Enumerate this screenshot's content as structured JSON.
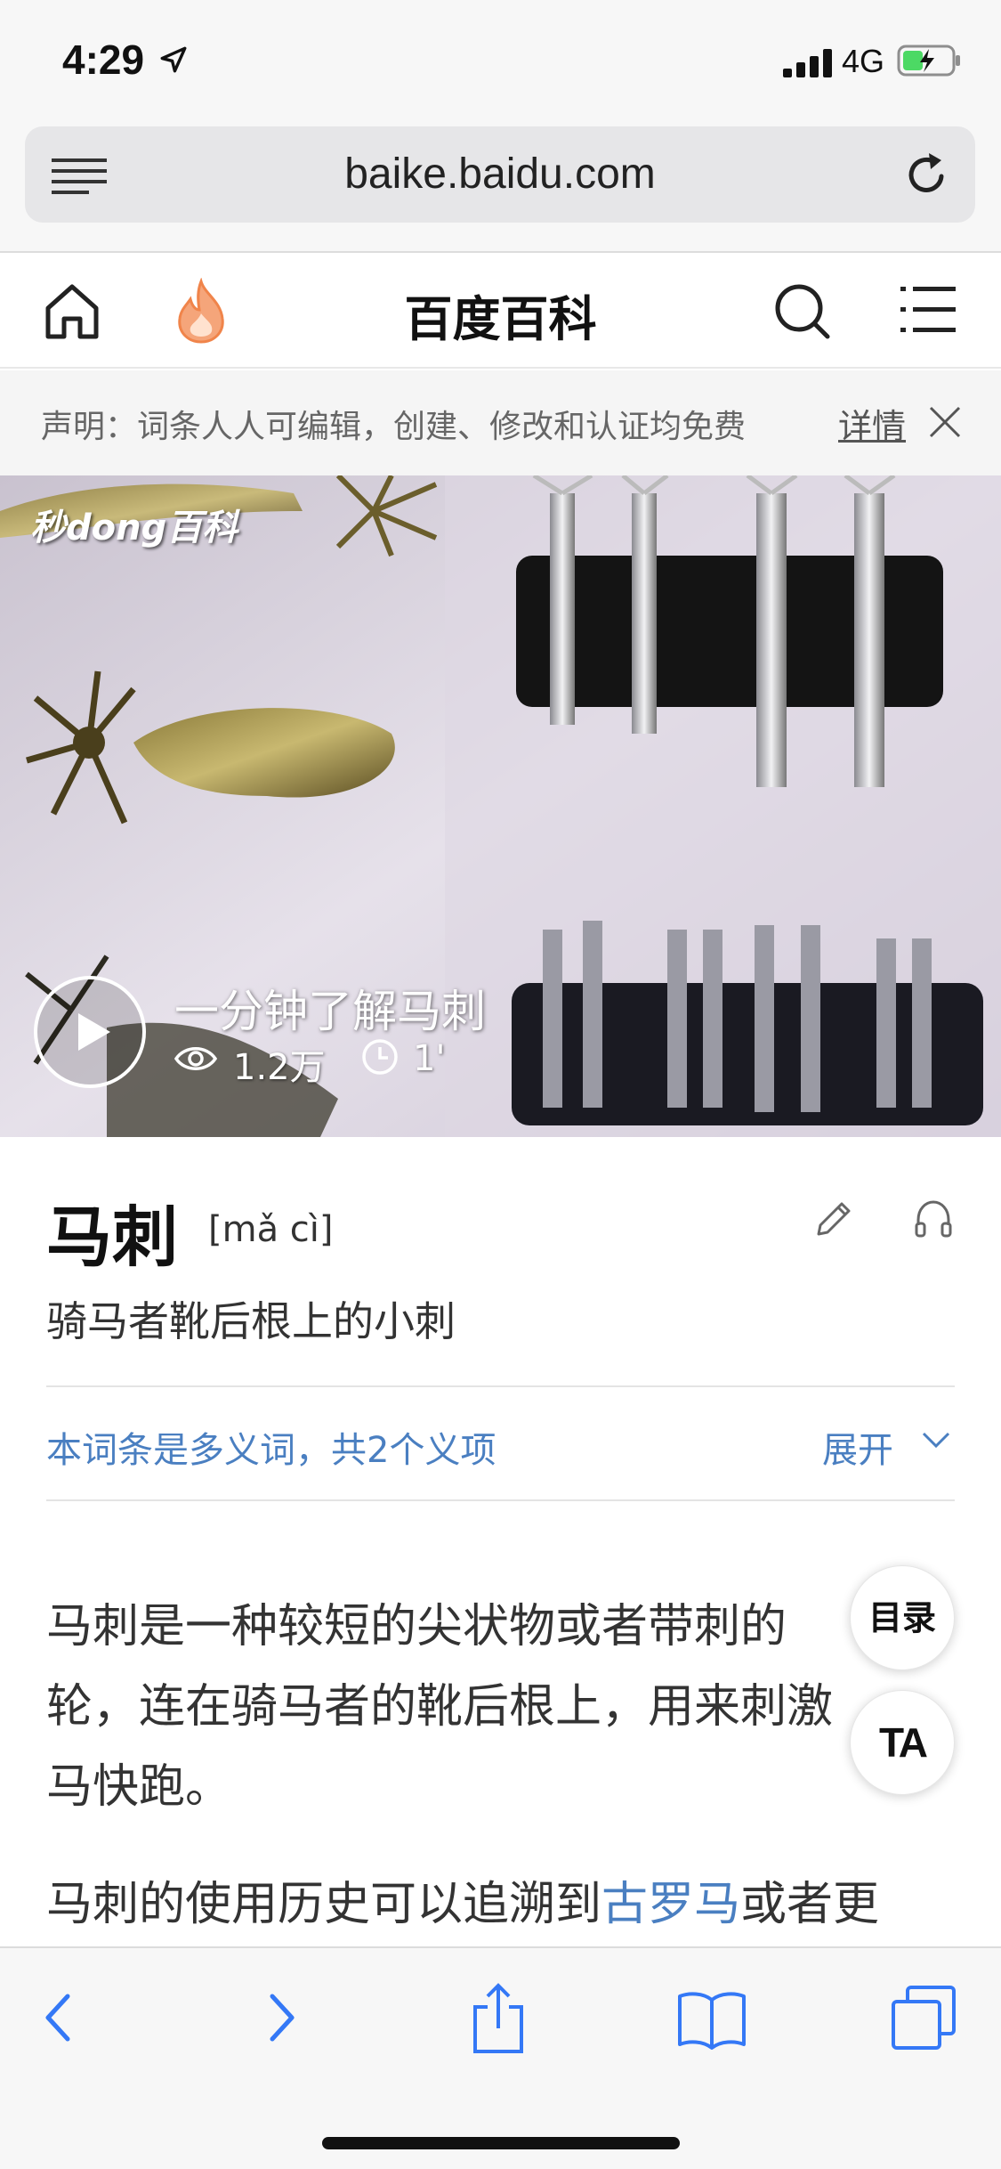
{
  "status": {
    "time": "4:29",
    "network": "4G"
  },
  "url_bar": {
    "url": "baike.baidu.com"
  },
  "header": {
    "title": "百度百科"
  },
  "notice": {
    "text": "声明：词条人人可编辑，创建、修改和认证均免费",
    "detail_label": "详情"
  },
  "video": {
    "watermark": "秒dong百科",
    "title": "一分钟了解马刺",
    "views": "1.2万",
    "duration": "1'"
  },
  "entry": {
    "title": "马刺",
    "pinyin": "[mǎ cì]",
    "summary": "骑马者靴后根上的小刺",
    "polysemy_text": "本词条是多义词，共2个义项",
    "expand_label": "展开",
    "paragraph1": "马刺是一种较短的尖状物或者带刺的轮，连在骑马者的靴后根上，用来刺激马快跑。",
    "paragraph2_before": "马刺的使用历史可以追溯到",
    "paragraph2_link": "古罗马",
    "paragraph2_after": "或者更"
  },
  "floating": {
    "toc_label": "目录",
    "font_label": "TA"
  },
  "colors": {
    "link": "#4a7fc1",
    "ios_blue": "#3478f6",
    "flame": "#f0844a"
  }
}
